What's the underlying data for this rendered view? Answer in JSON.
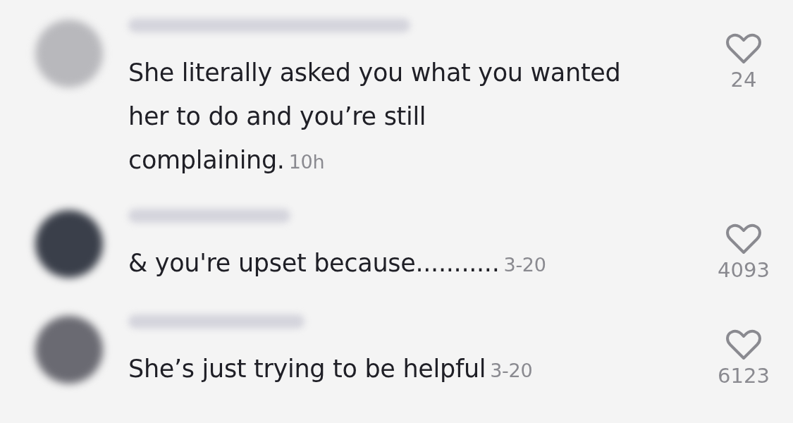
{
  "comments": [
    {
      "text": "She literally asked you what you wanted her to do and you’re still complaining.",
      "time": "10h",
      "likes": "24"
    },
    {
      "text": "& you're upset because...........",
      "time": "3-20",
      "likes": "4093"
    },
    {
      "text": "She’s just trying to be helpful",
      "time": "3-20",
      "likes": "6123"
    }
  ]
}
